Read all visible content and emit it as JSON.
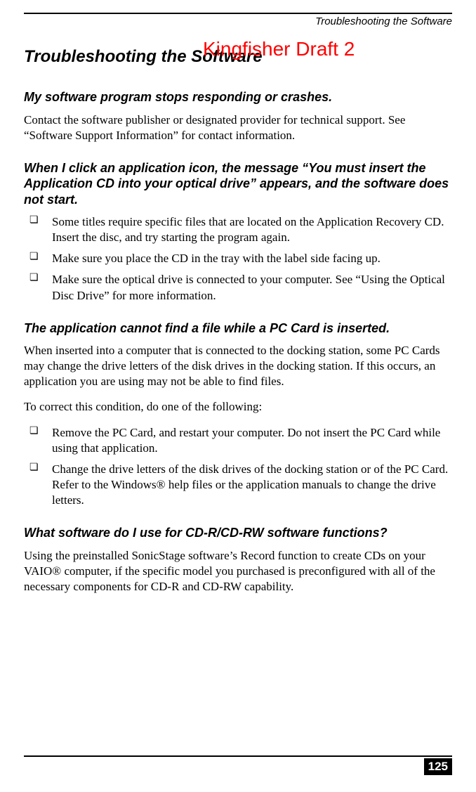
{
  "running_header": "Troubleshooting the Software",
  "page_title": "Troubleshooting the Software",
  "watermark": "Kingfisher Draft 2",
  "sections": [
    {
      "heading": "My software program stops responding or crashes.",
      "paragraphs": [
        "Contact the software publisher or designated provider for technical support. See “Software Support Information” for contact information."
      ],
      "bullets": []
    },
    {
      "heading": "When I click an application icon, the message “You must insert the Application CD into your optical drive” appears, and the software does not start.",
      "paragraphs": [],
      "bullets": [
        "Some titles require specific files that are located on the Application Recovery CD. Insert the disc, and try starting the program again.",
        "Make sure you place the CD in the tray with the label side facing up.",
        "Make sure the optical drive is connected to your computer. See “Using the Optical Disc Drive” for more information."
      ]
    },
    {
      "heading": "The application cannot find a file while a PC Card is inserted.",
      "paragraphs": [
        "When inserted into a computer that is connected to the docking station, some PC Cards may change the drive letters of the disk drives in the docking station. If this occurs, an application you are using may not be able to find files.",
        "To correct this condition, do one of the following:"
      ],
      "bullets": [
        "Remove the PC Card, and restart your computer. Do not insert the PC Card while using that application.",
        "Change the drive letters of the disk drives of the docking station or of the PC Card. Refer to the Windows® help files or the application manuals to change the drive letters."
      ]
    },
    {
      "heading": "What software do I use for CD-R/CD-RW software functions?",
      "paragraphs": [
        "Using the preinstalled SonicStage software’s Record function to create CDs on your VAIO® computer, if the specific model you purchased is preconfigured with all of the necessary components for CD-R and CD-RW capability."
      ],
      "bullets": []
    }
  ],
  "page_number": "125"
}
